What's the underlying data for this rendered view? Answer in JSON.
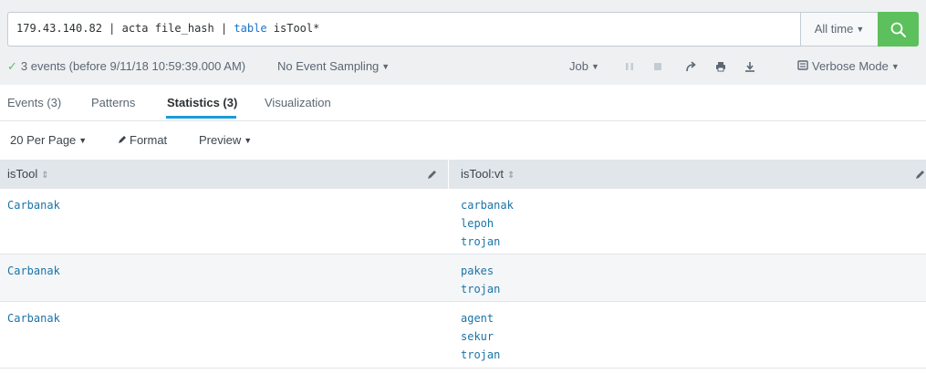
{
  "search": {
    "query_prefix": "179.43.140.82 | acta file_hash | ",
    "query_keyword": "table",
    "query_suffix": " isTool*",
    "time_range": "All time"
  },
  "status": {
    "events_text": "3 events (before 9/11/18 10:59:39.000 AM)",
    "sampling": "No Event Sampling",
    "job": "Job",
    "mode": "Verbose Mode"
  },
  "tabs": [
    "Events (3)",
    "Patterns",
    "Statistics (3)",
    "Visualization"
  ],
  "controls": {
    "per_page": "20 Per Page",
    "format": "Format",
    "preview": "Preview"
  },
  "table": {
    "columns": [
      "isTool",
      "isTool:vt"
    ],
    "rows": [
      {
        "isTool": "Carbanak",
        "vt": [
          "carbanak",
          "lepoh",
          "trojan"
        ]
      },
      {
        "isTool": "Carbanak",
        "vt": [
          "pakes",
          "trojan"
        ]
      },
      {
        "isTool": "Carbanak",
        "vt": [
          "agent",
          "sekur",
          "trojan"
        ]
      }
    ]
  },
  "colors": {
    "accent": "#1a9cd8",
    "search_button": "#5cc05c",
    "link": "#1a73a8"
  }
}
